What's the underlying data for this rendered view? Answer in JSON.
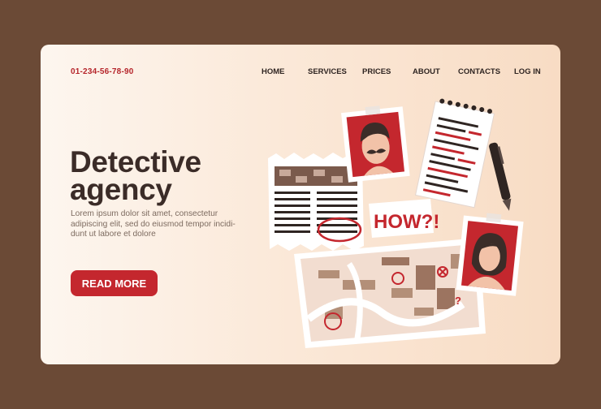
{
  "header": {
    "phone": "01-234-56-78-90",
    "nav": [
      "HOME",
      "SERVICES",
      "PRICES",
      "ABOUT",
      "CONTACTS",
      "LOG IN"
    ]
  },
  "hero": {
    "title": "Detective\nagency",
    "description": "Lorem ipsum dolor sit amet, consectetur adipiscing elit, sed do eiusmod tempor incidi-dunt ut labore et dolore",
    "button_label": "READ MORE"
  },
  "illustration": {
    "sticker_text": "HOW?!"
  },
  "colors": {
    "background": "#6b4a36",
    "accent": "#c4272e",
    "title": "#3b2c28"
  }
}
